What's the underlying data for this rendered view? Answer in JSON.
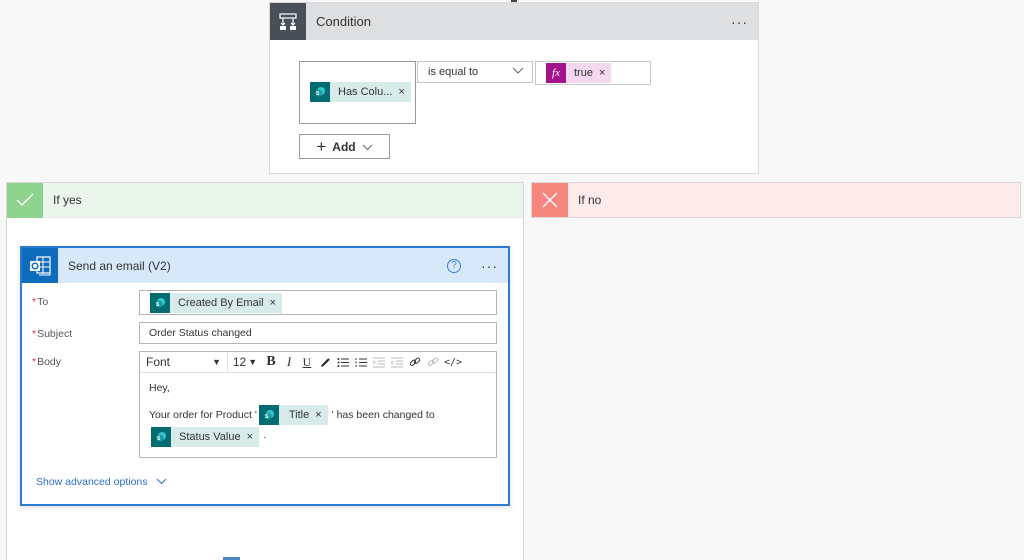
{
  "condition": {
    "title": "Condition",
    "more_label": "···",
    "left_token": {
      "label": "Has Colu...",
      "remove": "×",
      "icon": "sharepoint-icon"
    },
    "operator": "is equal to",
    "right_token": {
      "label": "true",
      "remove": "×",
      "icon": "fx-icon",
      "icon_text": "fx"
    },
    "add_label": "Add",
    "icon": "condition-icon"
  },
  "branches": {
    "yes": {
      "title": "If yes",
      "icon": "check-icon",
      "color": "#8ed38e"
    },
    "no": {
      "title": "If no",
      "icon": "close-icon",
      "color": "#f6877f"
    }
  },
  "email": {
    "title": "Send an email (V2)",
    "help_label": "?",
    "more_label": "···",
    "fields": {
      "to": {
        "label": "To",
        "required": "*",
        "token": "Created By Email",
        "remove": "×"
      },
      "subject": {
        "label": "Subject",
        "required": "*",
        "value": "Order Status changed"
      },
      "body": {
        "label": "Body",
        "required": "*",
        "toolbar": {
          "font": "Font",
          "size": "12",
          "caret": "▼",
          "bold": "B",
          "italic": "I",
          "underline": "U",
          "code": "</>"
        },
        "line1": "Hey,",
        "line2_prefix": "Your order for Product '",
        "title_token": "Title",
        "line2_suffix": "' has been changed to",
        "status_token": "Status Value",
        "line3_suffix": "·",
        "remove": "×"
      }
    },
    "advanced_label": "Show advanced options"
  },
  "colors": {
    "accent": "#2b7bd3",
    "sharepoint": "#036c70",
    "expression": "#a2148d",
    "condition_header": "#484f58"
  }
}
